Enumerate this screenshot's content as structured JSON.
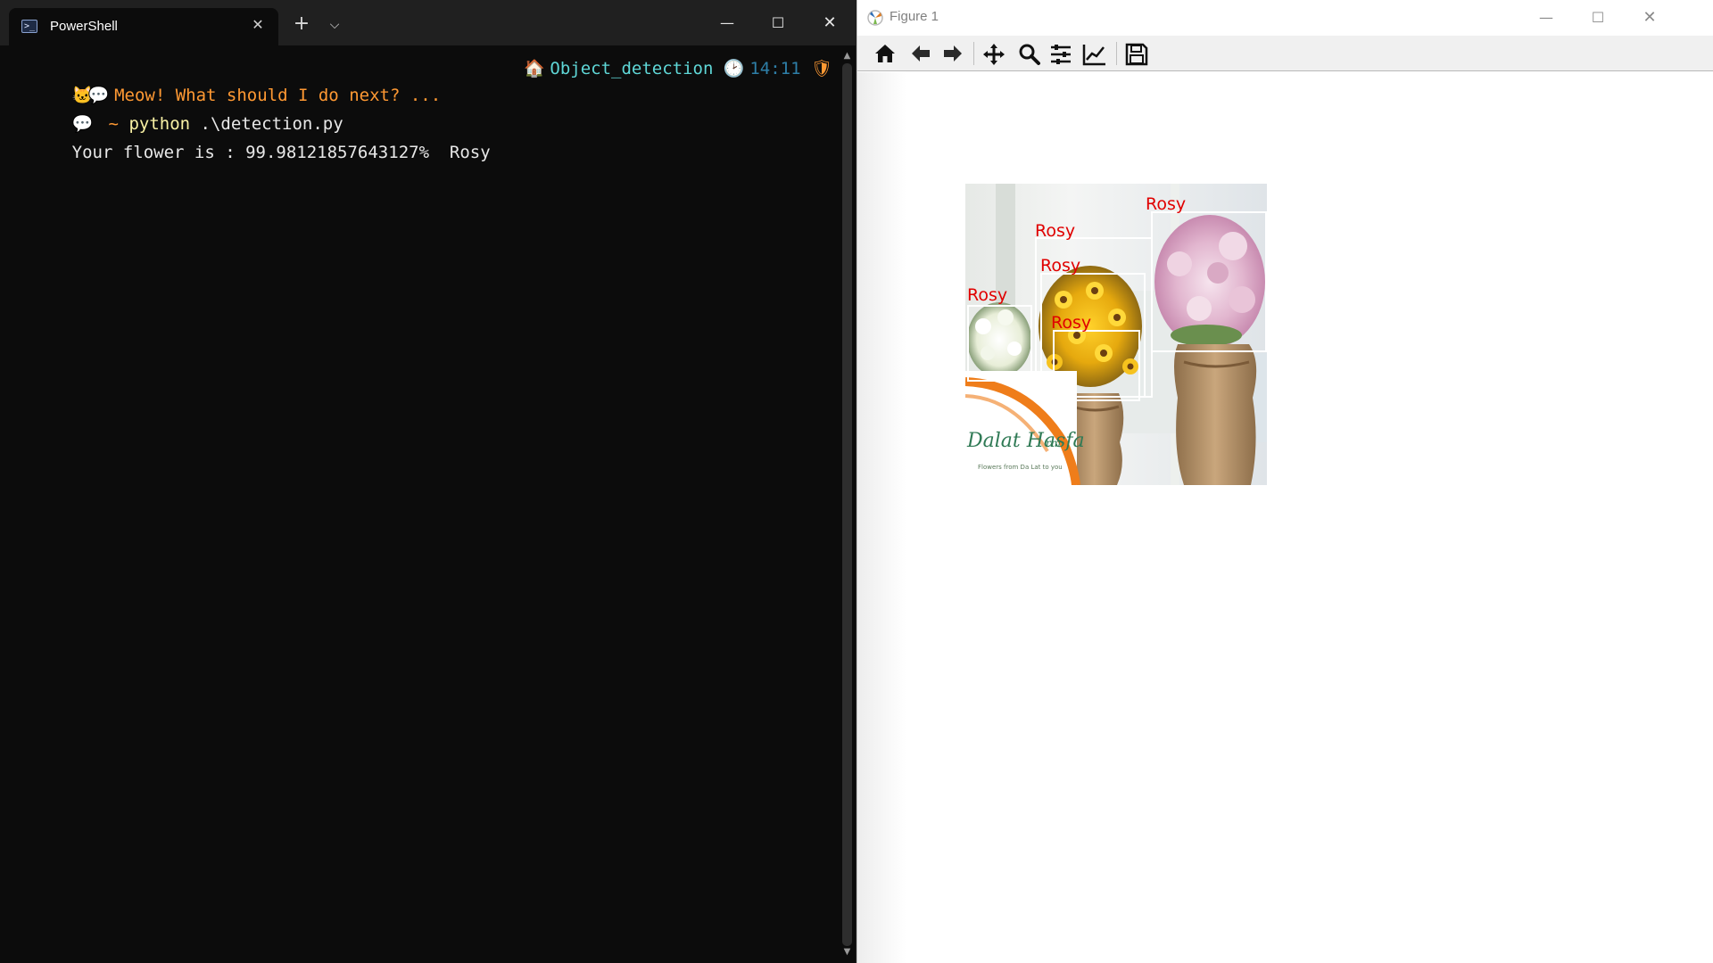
{
  "terminal": {
    "tab_title": "PowerShell",
    "icons": {
      "tab": "powershell-icon",
      "close": "close-icon",
      "new_tab": "plus-icon",
      "dropdown": "chevron-down-icon",
      "minimize": "minimize-icon",
      "maximize": "maximize-icon",
      "window_close": "close-icon"
    },
    "prompt": {
      "greeting": "Meow! What should I do next? ...",
      "folder": "Object_detection",
      "time": "14:11"
    },
    "command": {
      "tilde": "~",
      "program": "python",
      "args": ".\\detection.py"
    },
    "output": "Your flower is : 99.98121857643127%  Rosy"
  },
  "figure": {
    "title": "Figure 1",
    "toolbar": [
      {
        "name": "home-icon",
        "label": "Home"
      },
      {
        "name": "back-arrow-icon",
        "label": "Back"
      },
      {
        "name": "forward-arrow-icon",
        "label": "Forward"
      },
      {
        "name": "pan-icon",
        "label": "Pan"
      },
      {
        "name": "zoom-icon",
        "label": "Zoom"
      },
      {
        "name": "subplots-icon",
        "label": "Subplots"
      },
      {
        "name": "edit-axis-icon",
        "label": "Customize"
      },
      {
        "name": "save-icon",
        "label": "Save"
      }
    ],
    "detections": [
      {
        "label": "Rosy"
      },
      {
        "label": "Rosy"
      },
      {
        "label": "Rosy"
      },
      {
        "label": "Rosy"
      },
      {
        "label": "Rosy"
      }
    ],
    "watermark": "Dalat Hasfarm",
    "colors": {
      "label": "#e00000",
      "box": "#ffffff"
    }
  }
}
